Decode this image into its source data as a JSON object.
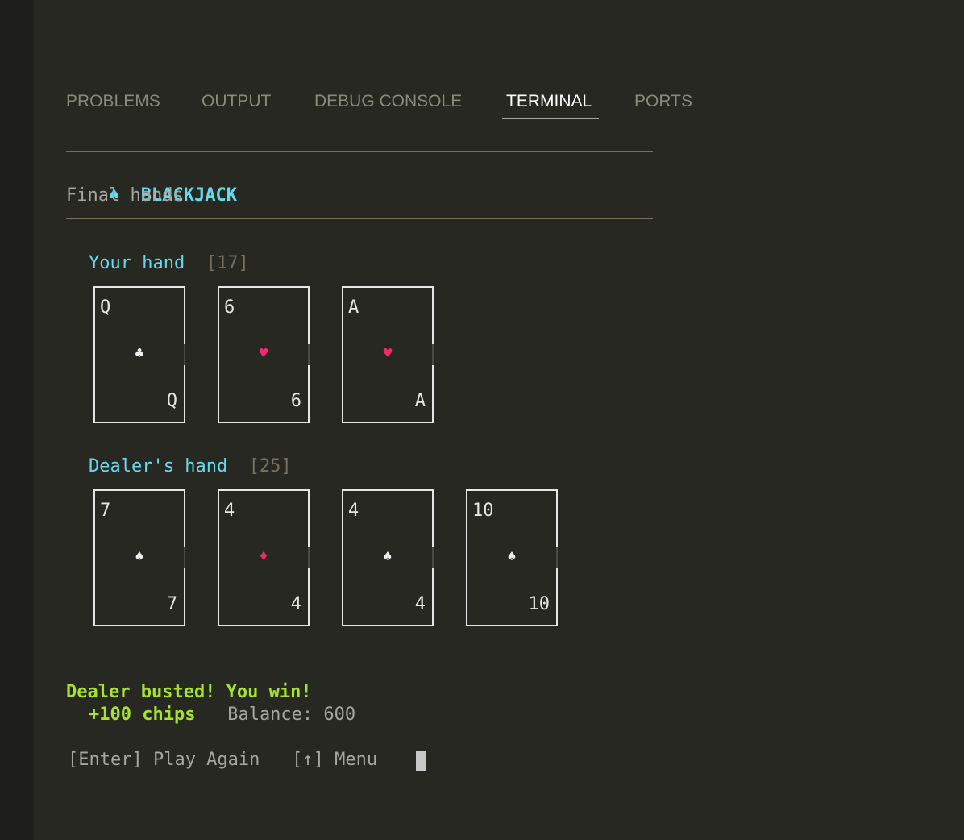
{
  "panel": {
    "tabs": [
      {
        "label": "PROBLEMS",
        "active": false
      },
      {
        "label": "OUTPUT",
        "active": false
      },
      {
        "label": "DEBUG CONSOLE",
        "active": false
      },
      {
        "label": "TERMINAL",
        "active": true
      },
      {
        "label": "PORTS",
        "active": false
      }
    ]
  },
  "game": {
    "icon": "spade-icon",
    "icon_glyph": "♠",
    "title": "BLACKJACK",
    "subtitle": "Final hands",
    "player": {
      "label": "Your hand",
      "total": "[17]",
      "cards": [
        {
          "rank": "Q",
          "suit": "♣",
          "color": "white"
        },
        {
          "rank": "6",
          "suit": "♥",
          "color": "red"
        },
        {
          "rank": "A",
          "suit": "♥",
          "color": "red"
        }
      ]
    },
    "dealer": {
      "label": "Dealer's hand",
      "total": "[25]",
      "cards": [
        {
          "rank": "7",
          "suit": "♠",
          "color": "white"
        },
        {
          "rank": "4",
          "suit": "♦",
          "color": "red"
        },
        {
          "rank": "4",
          "suit": "♠",
          "color": "white"
        },
        {
          "rank": "10",
          "suit": "♠",
          "color": "white"
        }
      ]
    },
    "result": "Dealer busted! You win!",
    "chips_delta": "+100 chips",
    "balance": "Balance: 600",
    "prompt_play": "[Enter] Play Again",
    "prompt_menu": "[↑] Menu"
  },
  "colors": {
    "background": "#272822",
    "accent_cyan": "#66d9ef",
    "win_green": "#a6e22e",
    "suit_red": "#f92672"
  }
}
